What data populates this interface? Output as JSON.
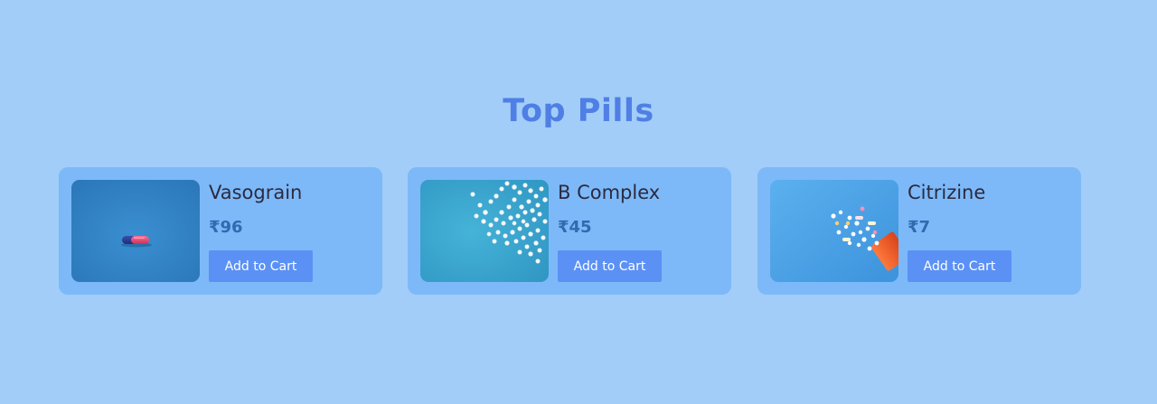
{
  "section": {
    "title": "Top Pills"
  },
  "products": [
    {
      "name": "Vasograin",
      "price": "₹96",
      "button_label": "Add to Cart",
      "image": "red-blue-capsule-photo"
    },
    {
      "name": "B Complex",
      "price": "₹45",
      "button_label": "Add to Cart",
      "image": "white-pills-scattered-photo"
    },
    {
      "name": "Citrizine",
      "price": "₹7",
      "button_label": "Add to Cart",
      "image": "pill-bottle-spill-photo"
    }
  ],
  "colors": {
    "page_background": "#a1cdf8",
    "card_background": "#7db9f8",
    "title": "#4f7ee5",
    "button": "#5b91f5",
    "price": "#2e6bb0"
  }
}
